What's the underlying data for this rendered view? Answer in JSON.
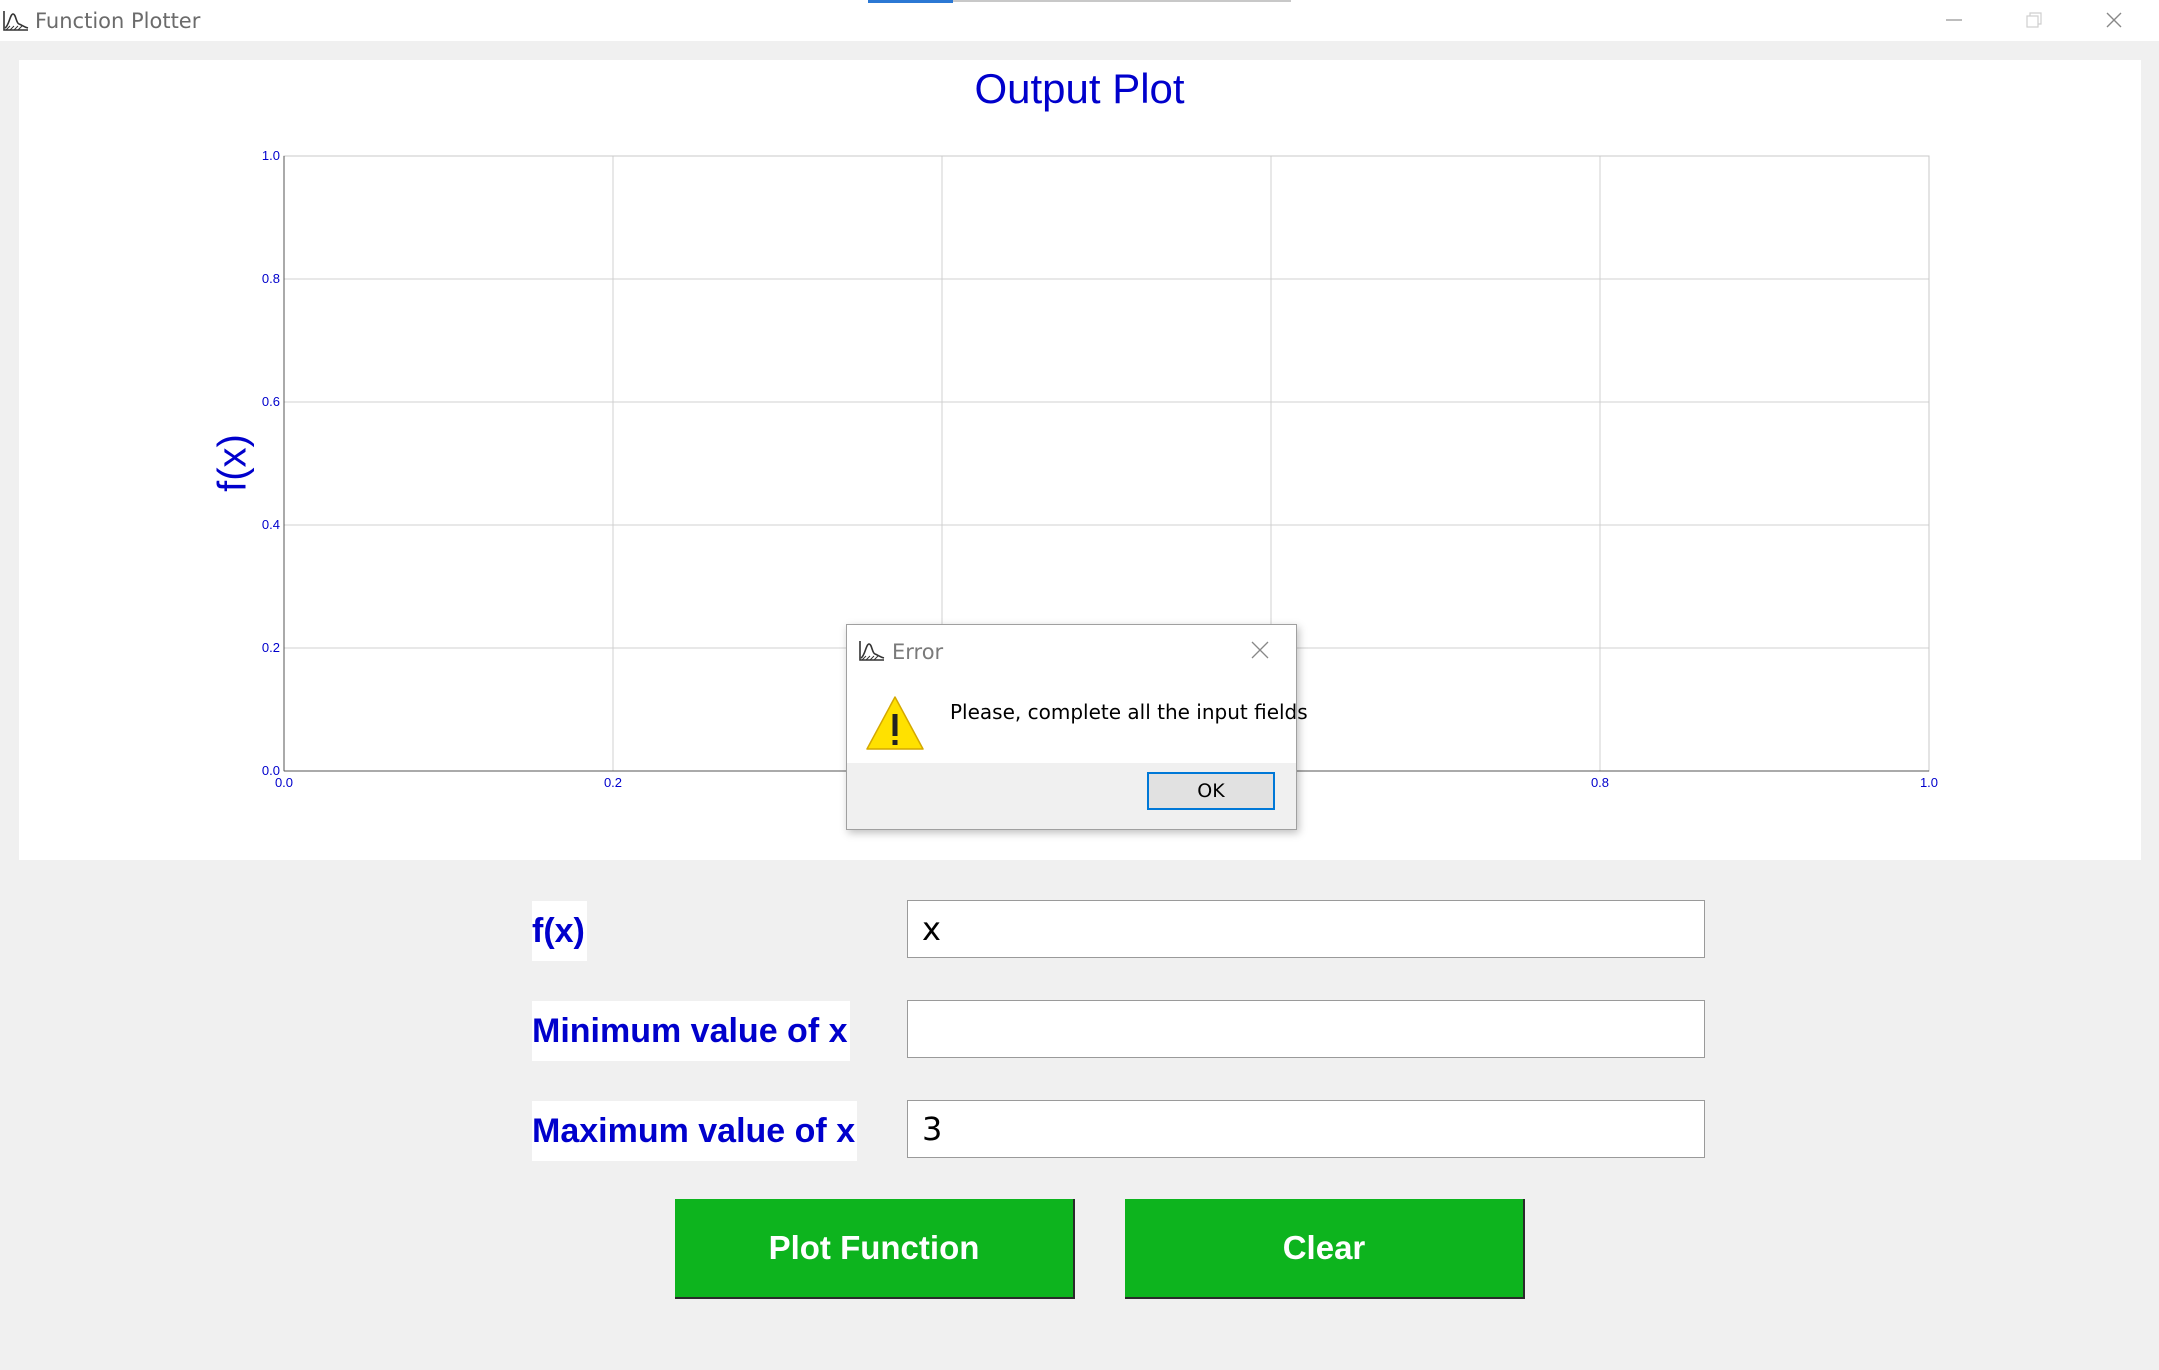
{
  "window": {
    "title": "Function Plotter",
    "icon": "function-graph-icon",
    "controls": [
      "minimize-icon",
      "restore-icon",
      "close-icon"
    ]
  },
  "plot": {
    "title": "Output Plot",
    "ylabel": "f(x)",
    "chart_data": {
      "type": "line",
      "title": "Output Plot",
      "xlabel": "",
      "ylabel": "f(x)",
      "xlim": [
        0.0,
        1.0
      ],
      "ylim": [
        0.0,
        1.0
      ],
      "x_ticks": [
        "0.0",
        "0.2",
        "0.4",
        "0.6",
        "0.8",
        "1.0"
      ],
      "y_ticks": [
        "0.0",
        "0.2",
        "0.4",
        "0.6",
        "0.8",
        "1.0"
      ],
      "grid": true,
      "series": []
    }
  },
  "form": {
    "fx_label": "f(x)",
    "fx_value": "x",
    "min_label": "Minimum value of x",
    "min_value": "",
    "max_label": "Maximum value of x",
    "max_value": "3"
  },
  "buttons": {
    "plot": "Plot Function",
    "clear": "Clear"
  },
  "dialog": {
    "title": "Error",
    "message": "Please, complete all the input fields",
    "ok": "OK",
    "icon": "warning-icon"
  },
  "colors": {
    "accent_text": "#0000cc",
    "button_green": "#0db41e",
    "focus_blue": "#0078d7"
  }
}
